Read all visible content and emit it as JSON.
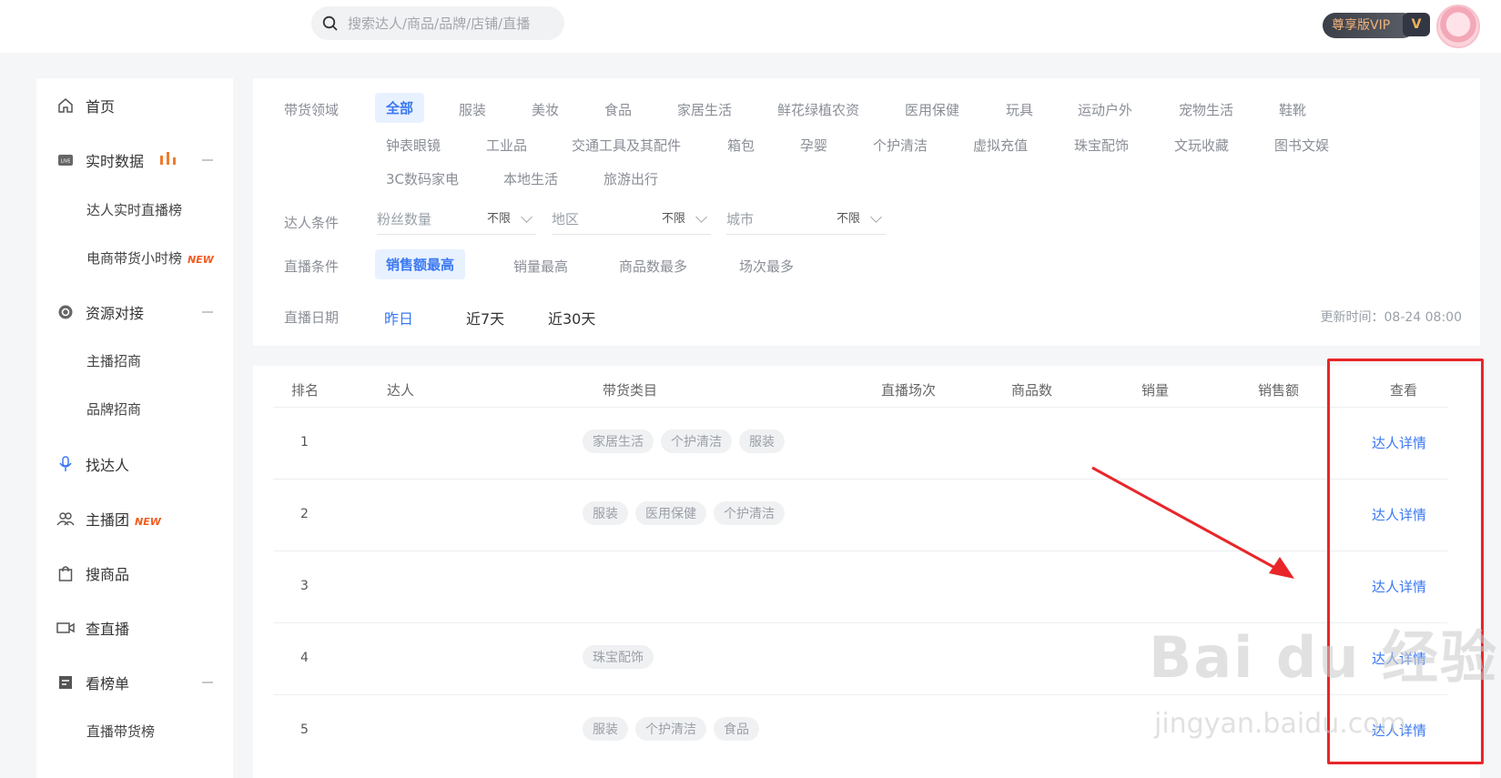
{
  "search": {
    "placeholder": "搜索达人/商品/品牌/店铺/直播"
  },
  "vip": {
    "label": "尊享版VIP",
    "badge": "V"
  },
  "sidebar": {
    "home": "首页",
    "realtime": "实时数据",
    "realtime_sub": [
      "达人实时直播榜",
      "电商带货小时榜"
    ],
    "new_tag": "NEW",
    "resource": "资源对接",
    "resource_sub": [
      "主播招商",
      "品牌招商"
    ],
    "find_talent": "找达人",
    "anchor_group": "主播团",
    "search_goods": "搜商品",
    "check_live": "查直播",
    "rankings": "看榜单",
    "rankings_sub": [
      "直播带货榜"
    ]
  },
  "filter": {
    "category_label": "带货领域",
    "categories_row1": [
      "全部",
      "服装",
      "美妆",
      "食品",
      "家居生活",
      "鲜花绿植农资",
      "医用保健",
      "玩具",
      "运动户外",
      "宠物生活",
      "鞋靴"
    ],
    "categories_row2": [
      "钟表眼镜",
      "工业品",
      "交通工具及其配件",
      "箱包",
      "孕婴",
      "个护清洁",
      "虚拟充值",
      "珠宝配饰",
      "文玩收藏",
      "图书文娱"
    ],
    "categories_row3": [
      "3C数码家电",
      "本地生活",
      "旅游出行"
    ],
    "talent_label": "达人条件",
    "dropdowns": [
      {
        "placeholder": "粉丝数量",
        "value": "不限"
      },
      {
        "placeholder": "地区",
        "value": "不限"
      },
      {
        "placeholder": "城市",
        "value": "不限"
      }
    ],
    "live_label": "直播条件",
    "live_options": [
      "销售额最高",
      "销量最高",
      "商品数最多",
      "场次最多"
    ],
    "date_label": "直播日期",
    "date_options": [
      "昨日",
      "近7天",
      "近30天"
    ],
    "update_time": "更新时间：08-24 08:00"
  },
  "table": {
    "headers": [
      "排名",
      "达人",
      "带货类目",
      "直播场次",
      "商品数",
      "销量",
      "销售额",
      "查看"
    ],
    "rows": [
      {
        "rank": "1",
        "tags": [
          "家居生活",
          "个护清洁",
          "服装"
        ],
        "action": "达人详情"
      },
      {
        "rank": "2",
        "tags": [
          "服装",
          "医用保健",
          "个护清洁"
        ],
        "action": "达人详情"
      },
      {
        "rank": "3",
        "tags": [],
        "action": "达人详情"
      },
      {
        "rank": "4",
        "tags": [
          "珠宝配饰"
        ],
        "action": "达人详情"
      },
      {
        "rank": "5",
        "tags": [
          "服装",
          "个护清洁",
          "食品"
        ],
        "action": "达人详情"
      }
    ]
  },
  "watermark": {
    "main": "Bai du 经验",
    "sub": "jingyan.baidu.com"
  },
  "colors": {
    "accent": "#3a78f2",
    "annotation": "#e8262a",
    "new": "#f25b1e"
  }
}
